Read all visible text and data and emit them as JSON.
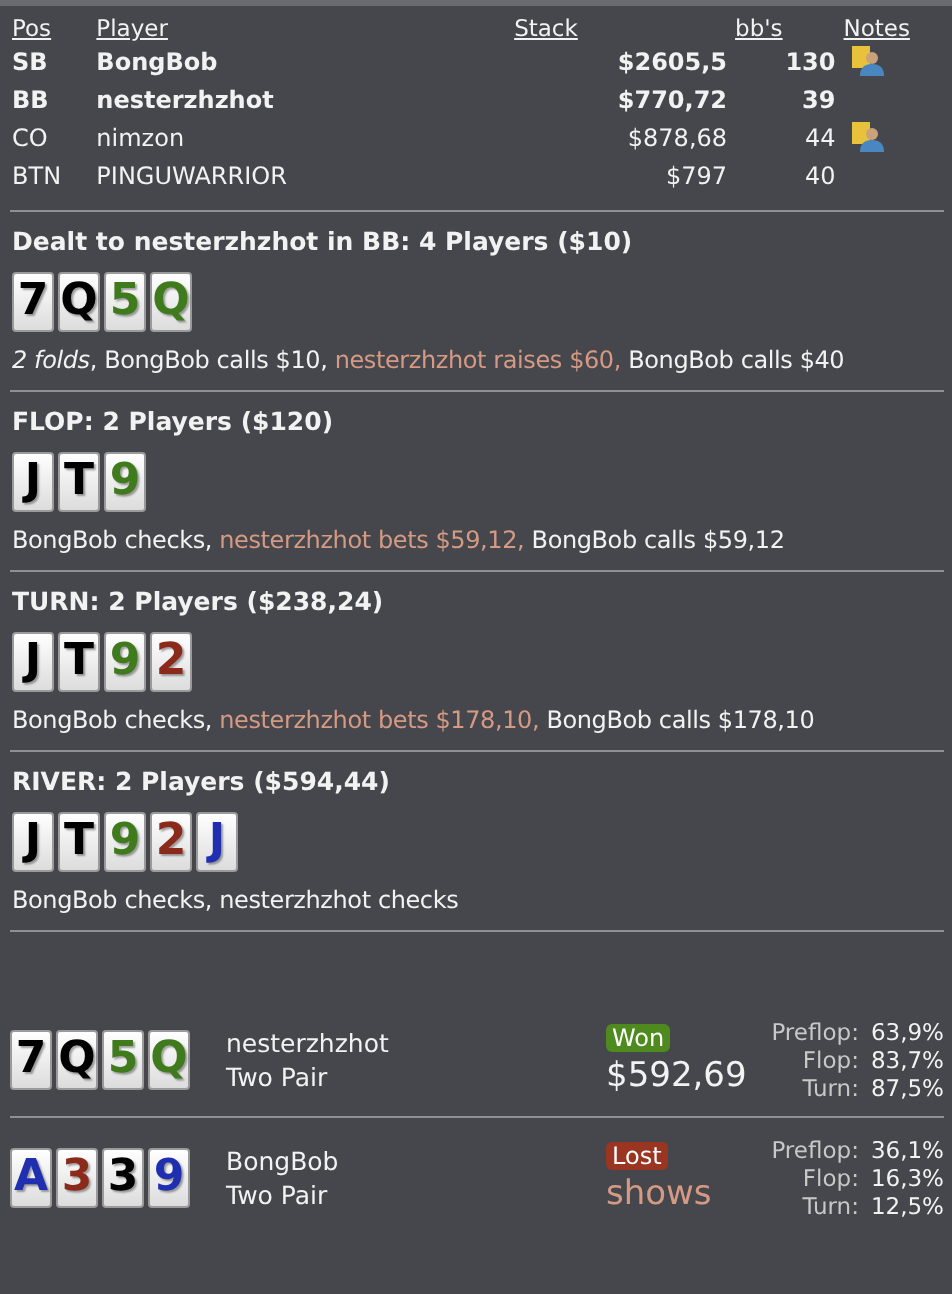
{
  "players": {
    "columns": [
      "Pos",
      "Player",
      "Stack",
      "bb's",
      "Notes"
    ],
    "rows": [
      {
        "pos": "SB",
        "name": "BongBob",
        "stack": "$2605,5",
        "bbs": "130",
        "in_hand": true,
        "has_note": true
      },
      {
        "pos": "BB",
        "name": "nesterzhzhot",
        "stack": "$770,72",
        "bbs": "39",
        "in_hand": true,
        "has_note": false
      },
      {
        "pos": "CO",
        "name": "nimzon",
        "stack": "$878,68",
        "bbs": "44",
        "in_hand": false,
        "has_note": true
      },
      {
        "pos": "BTN",
        "name": "PINGUWARRIOR",
        "stack": "$797",
        "bbs": "40",
        "in_hand": false,
        "has_note": false
      }
    ]
  },
  "streets": [
    {
      "title": "Dealt to nesterzhzhot in BB: 4 Players ($10)",
      "cards": [
        {
          "rank": "7",
          "color": "#000000"
        },
        {
          "rank": "Q",
          "color": "#000000"
        },
        {
          "rank": "5",
          "color": "#3f7a1c"
        },
        {
          "rank": "Q",
          "color": "#3f7a1c"
        }
      ],
      "actions": [
        {
          "kind": "fold",
          "text": "*2 folds*,"
        },
        {
          "kind": "passive",
          "text": "BongBob calls $10,"
        },
        {
          "kind": "aggressive",
          "text": "nesterzhzhot raises $60,"
        },
        {
          "kind": "passive",
          "text": "BongBob calls $40"
        }
      ]
    },
    {
      "title": "FLOP: 2 Players ($120)",
      "cards": [
        {
          "rank": "J",
          "color": "#000000"
        },
        {
          "rank": "T",
          "color": "#000000"
        },
        {
          "rank": "9",
          "color": "#3f7a1c"
        }
      ],
      "actions": [
        {
          "kind": "passive",
          "text": "BongBob checks,"
        },
        {
          "kind": "aggressive",
          "text": "nesterzhzhot bets $59,12,"
        },
        {
          "kind": "passive",
          "text": "BongBob calls $59,12"
        }
      ]
    },
    {
      "title": "TURN: 2 Players ($238,24)",
      "cards": [
        {
          "rank": "J",
          "color": "#000000"
        },
        {
          "rank": "T",
          "color": "#000000"
        },
        {
          "rank": "9",
          "color": "#3f7a1c"
        },
        {
          "rank": "2",
          "color": "#8b2a1a"
        }
      ],
      "actions": [
        {
          "kind": "passive",
          "text": "BongBob checks,"
        },
        {
          "kind": "aggressive",
          "text": "nesterzhzhot bets $178,10,"
        },
        {
          "kind": "passive",
          "text": "BongBob calls $178,10"
        }
      ]
    },
    {
      "title": "RIVER: 2 Players ($594,44)",
      "cards": [
        {
          "rank": "J",
          "color": "#000000"
        },
        {
          "rank": "T",
          "color": "#000000"
        },
        {
          "rank": "9",
          "color": "#3f7a1c"
        },
        {
          "rank": "2",
          "color": "#8b2a1a"
        },
        {
          "rank": "J",
          "color": "#1f2fb0"
        }
      ],
      "actions": [
        {
          "kind": "passive",
          "text": "BongBob checks, nesterzhzhot checks"
        }
      ]
    }
  ],
  "results": [
    {
      "cards": [
        {
          "rank": "7",
          "color": "#000000"
        },
        {
          "rank": "Q",
          "color": "#000000"
        },
        {
          "rank": "5",
          "color": "#3f7a1c"
        },
        {
          "rank": "Q",
          "color": "#3f7a1c"
        }
      ],
      "name": "nesterzhzhot",
      "hand": "Two Pair",
      "won": true,
      "badge": "Won",
      "amount": "$592,69",
      "equity": [
        {
          "label": "Preflop:",
          "value": "63,9%"
        },
        {
          "label": "Flop:",
          "value": "83,7%"
        },
        {
          "label": "Turn:",
          "value": "87,5%"
        }
      ]
    },
    {
      "cards": [
        {
          "rank": "A",
          "color": "#1f2fb0"
        },
        {
          "rank": "3",
          "color": "#8b2a1a"
        },
        {
          "rank": "3",
          "color": "#000000"
        },
        {
          "rank": "9",
          "color": "#1f2fb0"
        }
      ],
      "name": "BongBob",
      "hand": "Two Pair",
      "won": false,
      "badge": "Lost",
      "amount": "shows",
      "equity": [
        {
          "label": "Preflop:",
          "value": "36,1%"
        },
        {
          "label": "Flop:",
          "value": "16,3%"
        },
        {
          "label": "Turn:",
          "value": "12,5%"
        }
      ]
    }
  ]
}
